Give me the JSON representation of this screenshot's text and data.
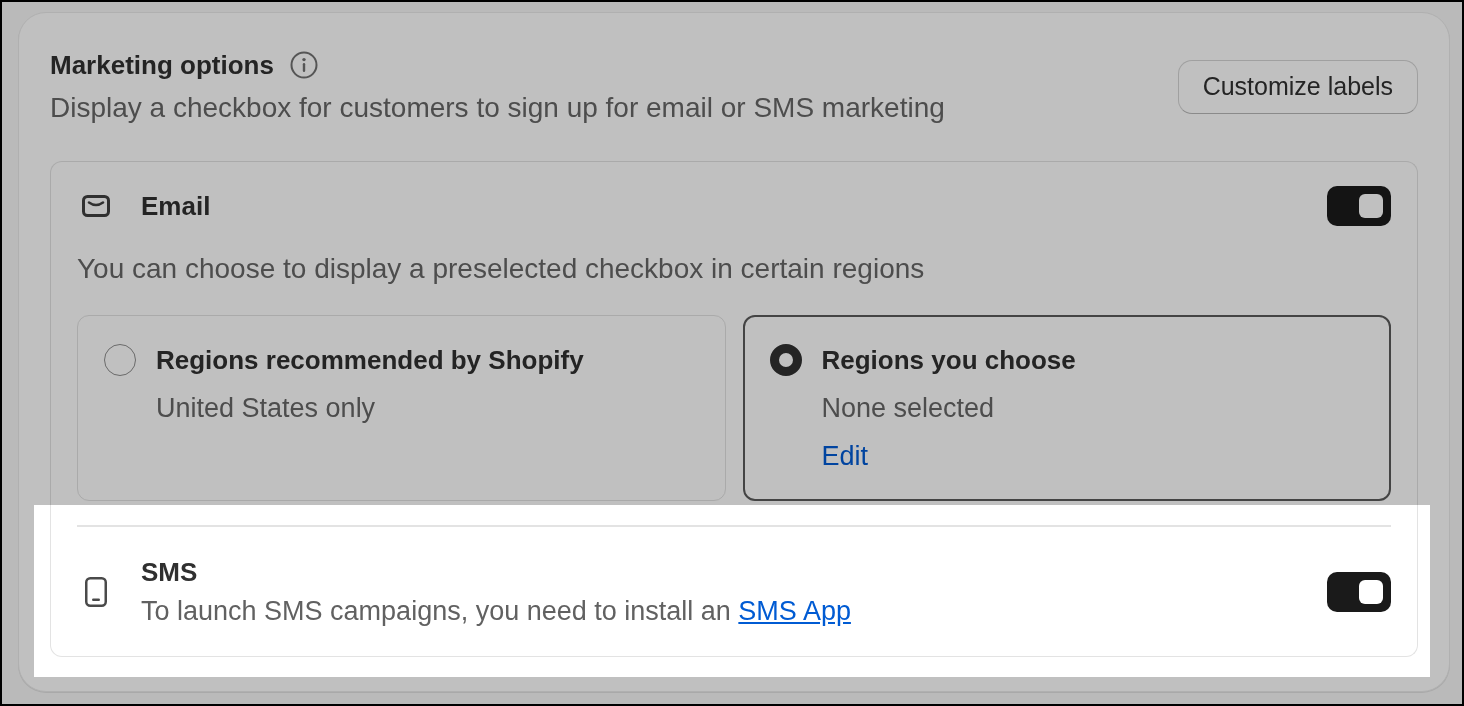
{
  "section": {
    "title": "Marketing options",
    "description": "Display a checkbox for customers to sign up for email or SMS marketing",
    "button": "Customize labels"
  },
  "channels": [
    {
      "kind": "email",
      "label": "Email",
      "on": true,
      "highlighted": false,
      "note": "You can choose to display a preselected checkbox in certain regions",
      "options": [
        {
          "title": "Regions recommended by Shopify",
          "detail": "United States only",
          "selected": false
        },
        {
          "title": "Regions you choose",
          "detail": "None selected",
          "link": "Edit",
          "selected": true
        }
      ]
    },
    {
      "kind": "sms",
      "label": "SMS",
      "on": true,
      "highlighted": true,
      "description": "To launch SMS campaigns, you need to install an",
      "link": "SMS App"
    }
  ]
}
